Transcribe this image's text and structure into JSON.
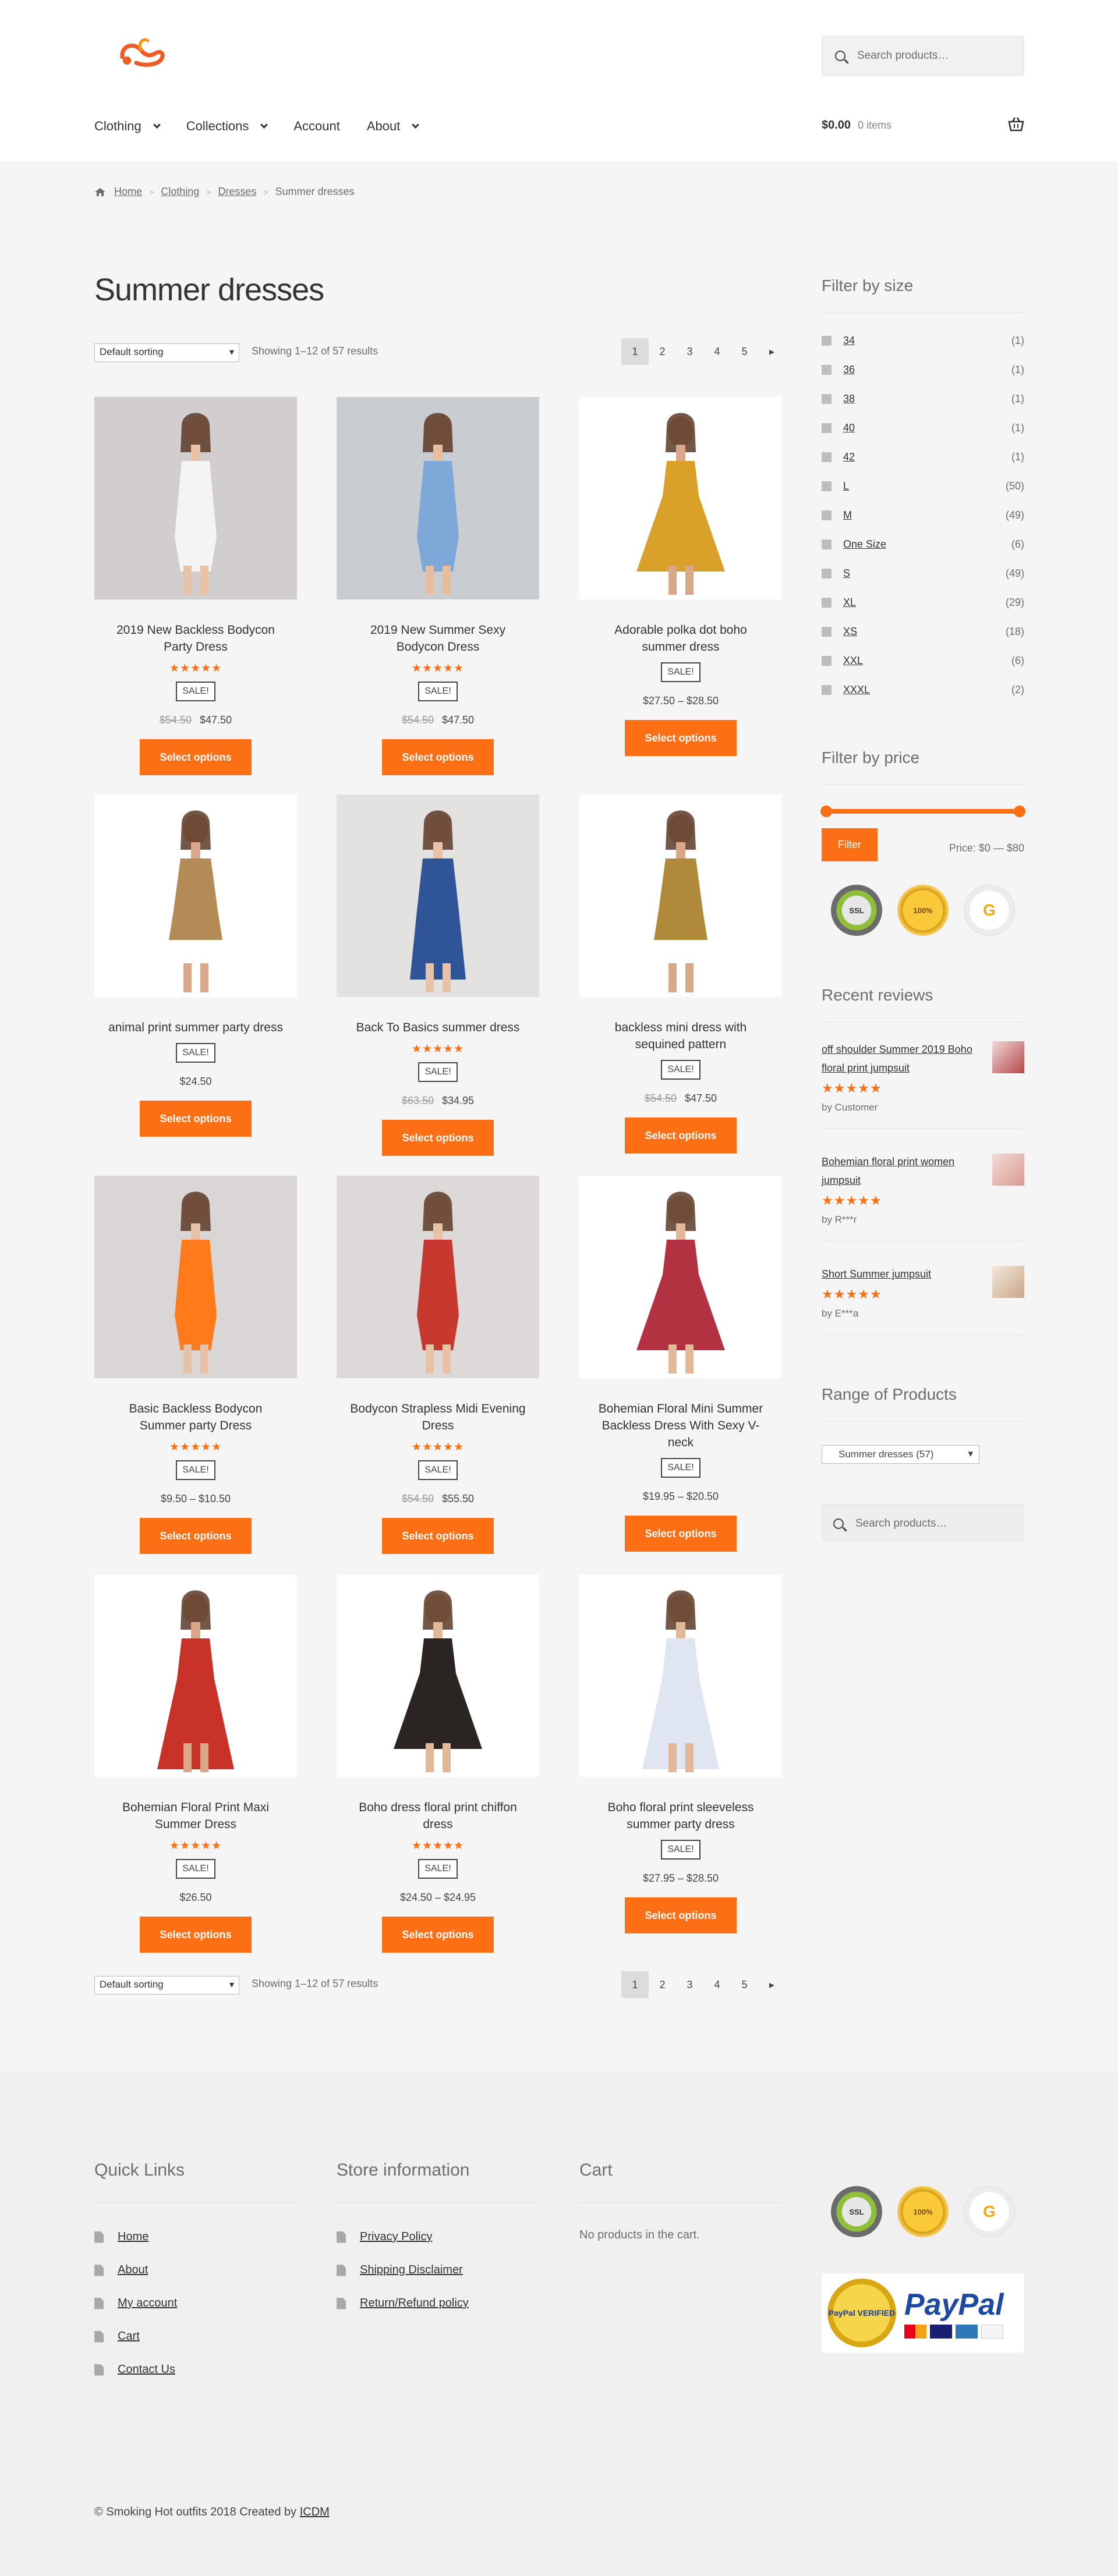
{
  "header": {
    "search_placeholder": "Search products…",
    "nav": [
      {
        "label": "Clothing"
      },
      {
        "label": "Collections"
      },
      {
        "label": "Account"
      },
      {
        "label": "About"
      }
    ],
    "cart_amount": "$0.00",
    "cart_count": "0 items"
  },
  "breadcrumb": [
    "Home",
    "Clothing",
    "Dresses",
    "Summer dresses"
  ],
  "page_title": "Summer dresses",
  "sort": {
    "selected": "Default sorting"
  },
  "result_count": "Showing 1–12 of 57 results",
  "pagination": [
    "1",
    "2",
    "3",
    "4",
    "5"
  ],
  "products": [
    {
      "name": "2019 New Backless Bodycon Party Dress",
      "rating": 5,
      "stars": "★★★★★",
      "sale": "SALE!",
      "old_price": "$54.50",
      "price": "$47.50",
      "button": "Select options"
    },
    {
      "name": "2019 New Summer Sexy Bodycon Dress",
      "rating": 5,
      "stars": "★★★★★",
      "sale": "SALE!",
      "old_price": "$54.50",
      "price": "$47.50",
      "button": "Select options"
    },
    {
      "name": "Adorable polka dot boho summer dress",
      "rating": 0,
      "stars": "",
      "sale": "SALE!",
      "old_price": "",
      "price": "$27.50 – $28.50",
      "button": "Select options"
    },
    {
      "name": "animal print summer party dress",
      "rating": 0,
      "stars": "",
      "sale": "SALE!",
      "old_price": "",
      "price": "$24.50",
      "button": "Select options"
    },
    {
      "name": "Back To Basics summer dress",
      "rating": 5,
      "stars": "★★★★★",
      "sale": "SALE!",
      "old_price": "$63.50",
      "price": "$34.95",
      "button": "Select options"
    },
    {
      "name": "backless mini dress with sequined pattern",
      "rating": 0,
      "stars": "",
      "sale": "SALE!",
      "old_price": "$54.50",
      "price": "$47.50",
      "button": "Select options"
    },
    {
      "name": "Basic Backless Bodycon Summer party Dress",
      "rating": 5,
      "stars": "★★★★★",
      "sale": "SALE!",
      "old_price": "",
      "price": "$9.50 – $10.50",
      "button": "Select options"
    },
    {
      "name": "Bodycon Strapless Midi Evening Dress",
      "rating": 5,
      "stars": "★★★★★",
      "sale": "SALE!",
      "old_price": "$54.50",
      "price": "$55.50",
      "button": "Select options"
    },
    {
      "name": "Bohemian Floral Mini Summer Backless Dress With Sexy V-neck",
      "rating": 0,
      "stars": "",
      "sale": "SALE!",
      "old_price": "",
      "price": "$19.95 – $20.50",
      "button": "Select options"
    },
    {
      "name": "Bohemian Floral Print Maxi Summer Dress",
      "rating": 5,
      "stars": "★★★★★",
      "sale": "SALE!",
      "old_price": "",
      "price": "$26.50",
      "button": "Select options"
    },
    {
      "name": "Boho dress floral print chiffon dress",
      "rating": 5,
      "stars": "★★★★★",
      "sale": "SALE!",
      "old_price": "",
      "price": "$24.50 – $24.95",
      "button": "Select options"
    },
    {
      "name": "Boho floral print sleeveless summer party dress",
      "rating": 0,
      "stars": "",
      "sale": "SALE!",
      "old_price": "",
      "price": "$27.95 – $28.50",
      "button": "Select options"
    }
  ],
  "sidebar": {
    "size_title": "Filter by size",
    "sizes": [
      {
        "label": "34",
        "count": "(1)"
      },
      {
        "label": "36",
        "count": "(1)"
      },
      {
        "label": "38",
        "count": "(1)"
      },
      {
        "label": "40",
        "count": "(1)"
      },
      {
        "label": "42",
        "count": "(1)"
      },
      {
        "label": "L",
        "count": "(50)"
      },
      {
        "label": "M",
        "count": "(49)"
      },
      {
        "label": "One Size",
        "count": "(6)"
      },
      {
        "label": "S",
        "count": "(49)"
      },
      {
        "label": "XL",
        "count": "(29)"
      },
      {
        "label": "XS",
        "count": "(18)"
      },
      {
        "label": "XXL",
        "count": "(6)"
      },
      {
        "label": "XXXL",
        "count": "(2)"
      }
    ],
    "price_title": "Filter by price",
    "filter_button": "Filter",
    "price_label": "Price: $0 — $80",
    "badge_ssl": "SSL",
    "badge_gold": "100%",
    "badge_g": "G",
    "reviews_title": "Recent reviews",
    "reviews": [
      {
        "title": "off shoulder Summer 2019 Boho floral print jumpsuit",
        "stars": "★★★★★",
        "by": "by Customer"
      },
      {
        "title": "Bohemian floral print women jumpsuit",
        "stars": "★★★★★",
        "by": "by R***r"
      },
      {
        "title": "Short Summer jumpsuit",
        "stars": "★★★★★",
        "by": "by E***a"
      }
    ],
    "range_title": "Range of Products",
    "range_selected": "Summer dresses  (57)",
    "search_placeholder": "Search products…"
  },
  "footer": {
    "quick_links_title": "Quick Links",
    "quick_links": [
      "Home",
      "About",
      "My account",
      "Cart",
      "Contact Us"
    ],
    "store_title": "Store information",
    "store_links": [
      "Privacy Policy",
      "Shipping Disclaimer",
      "Return/Refund policy"
    ],
    "cart_title": "Cart",
    "cart_empty": "No products in the cart.",
    "paypal_text": "PayPal",
    "paypal_verified": "PayPal VERIFIED",
    "copyright": "© Smoking Hot outfits 2018 Created by ",
    "copyright_link": "ICDM"
  },
  "colors": {
    "accent": "#fc6f15",
    "page_bg": "#f5f5f5"
  }
}
